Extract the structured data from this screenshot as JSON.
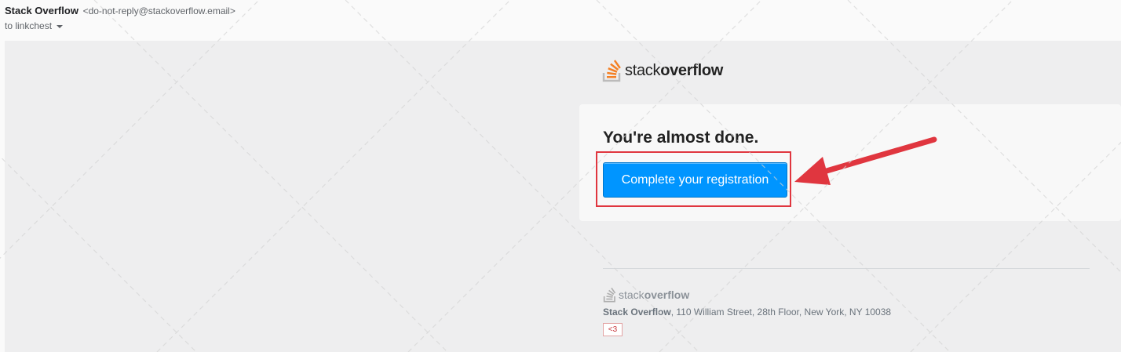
{
  "header": {
    "sender_name": "Stack Overflow",
    "sender_email": "<do-not-reply@stackoverflow.email>",
    "recipient": "to linkchest"
  },
  "email": {
    "logo": {
      "text_light": "stack",
      "text_bold": "overflow"
    },
    "headline": "You're almost done.",
    "cta_label": "Complete your registration",
    "footer": {
      "logo_light": "stack",
      "logo_bold": "overflow",
      "company": "Stack Overflow",
      "address": ", 110 William Street, 28th Floor, New York, NY 10038",
      "heart_link": "<3"
    }
  },
  "annotation": {
    "color": "#e0363f"
  },
  "colors": {
    "button": "#0095ff",
    "brand_orange": "#f48024"
  }
}
